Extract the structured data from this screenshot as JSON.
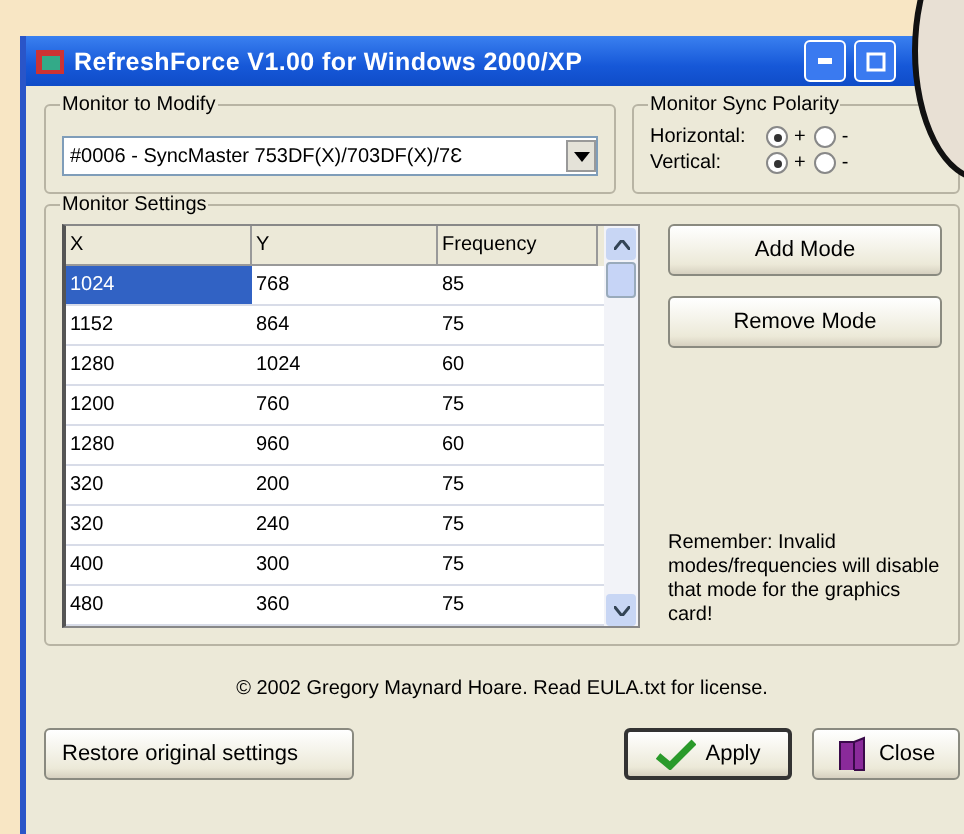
{
  "window": {
    "title": "RefreshForce V1.00 for Windows 2000/XP"
  },
  "monitor_group": {
    "label": "Monitor to Modify",
    "select_value": "#0006 - SyncMaster 753DF(X)/703DF(X)/7Ɛ"
  },
  "polarity_group": {
    "label": "Monitor Sync Polarity",
    "rows": [
      {
        "label": "Horizontal:",
        "options": [
          {
            "label": "+",
            "selected": true
          },
          {
            "label": "-",
            "selected": false
          }
        ]
      },
      {
        "label": "Vertical:",
        "options": [
          {
            "label": "+",
            "selected": true
          },
          {
            "label": "-",
            "selected": false
          }
        ]
      }
    ]
  },
  "settings_group": {
    "label": "Monitor Settings",
    "table": {
      "columns": [
        "X",
        "Y",
        "Frequency"
      ],
      "rows": [
        {
          "cells": [
            "1024",
            "768",
            "85"
          ],
          "selected": true
        },
        {
          "cells": [
            "1152",
            "864",
            "75"
          ],
          "selected": false
        },
        {
          "cells": [
            "1280",
            "1024",
            "60"
          ],
          "selected": false
        },
        {
          "cells": [
            "1200",
            "760",
            "75"
          ],
          "selected": false
        },
        {
          "cells": [
            "1280",
            "960",
            "60"
          ],
          "selected": false
        },
        {
          "cells": [
            "320",
            "200",
            "75"
          ],
          "selected": false
        },
        {
          "cells": [
            "320",
            "240",
            "75"
          ],
          "selected": false
        },
        {
          "cells": [
            "400",
            "300",
            "75"
          ],
          "selected": false
        },
        {
          "cells": [
            "480",
            "360",
            "75"
          ],
          "selected": false
        }
      ]
    },
    "buttons": [
      "Add Mode",
      "Remove Mode"
    ],
    "note": "Remember: Invalid modes/frequencies will disable that mode for the graphics card!"
  },
  "copyright": "© 2002 Gregory Maynard Hoare.  Read EULA.txt for license.",
  "footer_buttons": [
    {
      "kind": "plain",
      "label": "Restore original settings"
    },
    {
      "kind": "apply",
      "label": "Apply"
    },
    {
      "kind": "close",
      "label": "Close"
    }
  ]
}
